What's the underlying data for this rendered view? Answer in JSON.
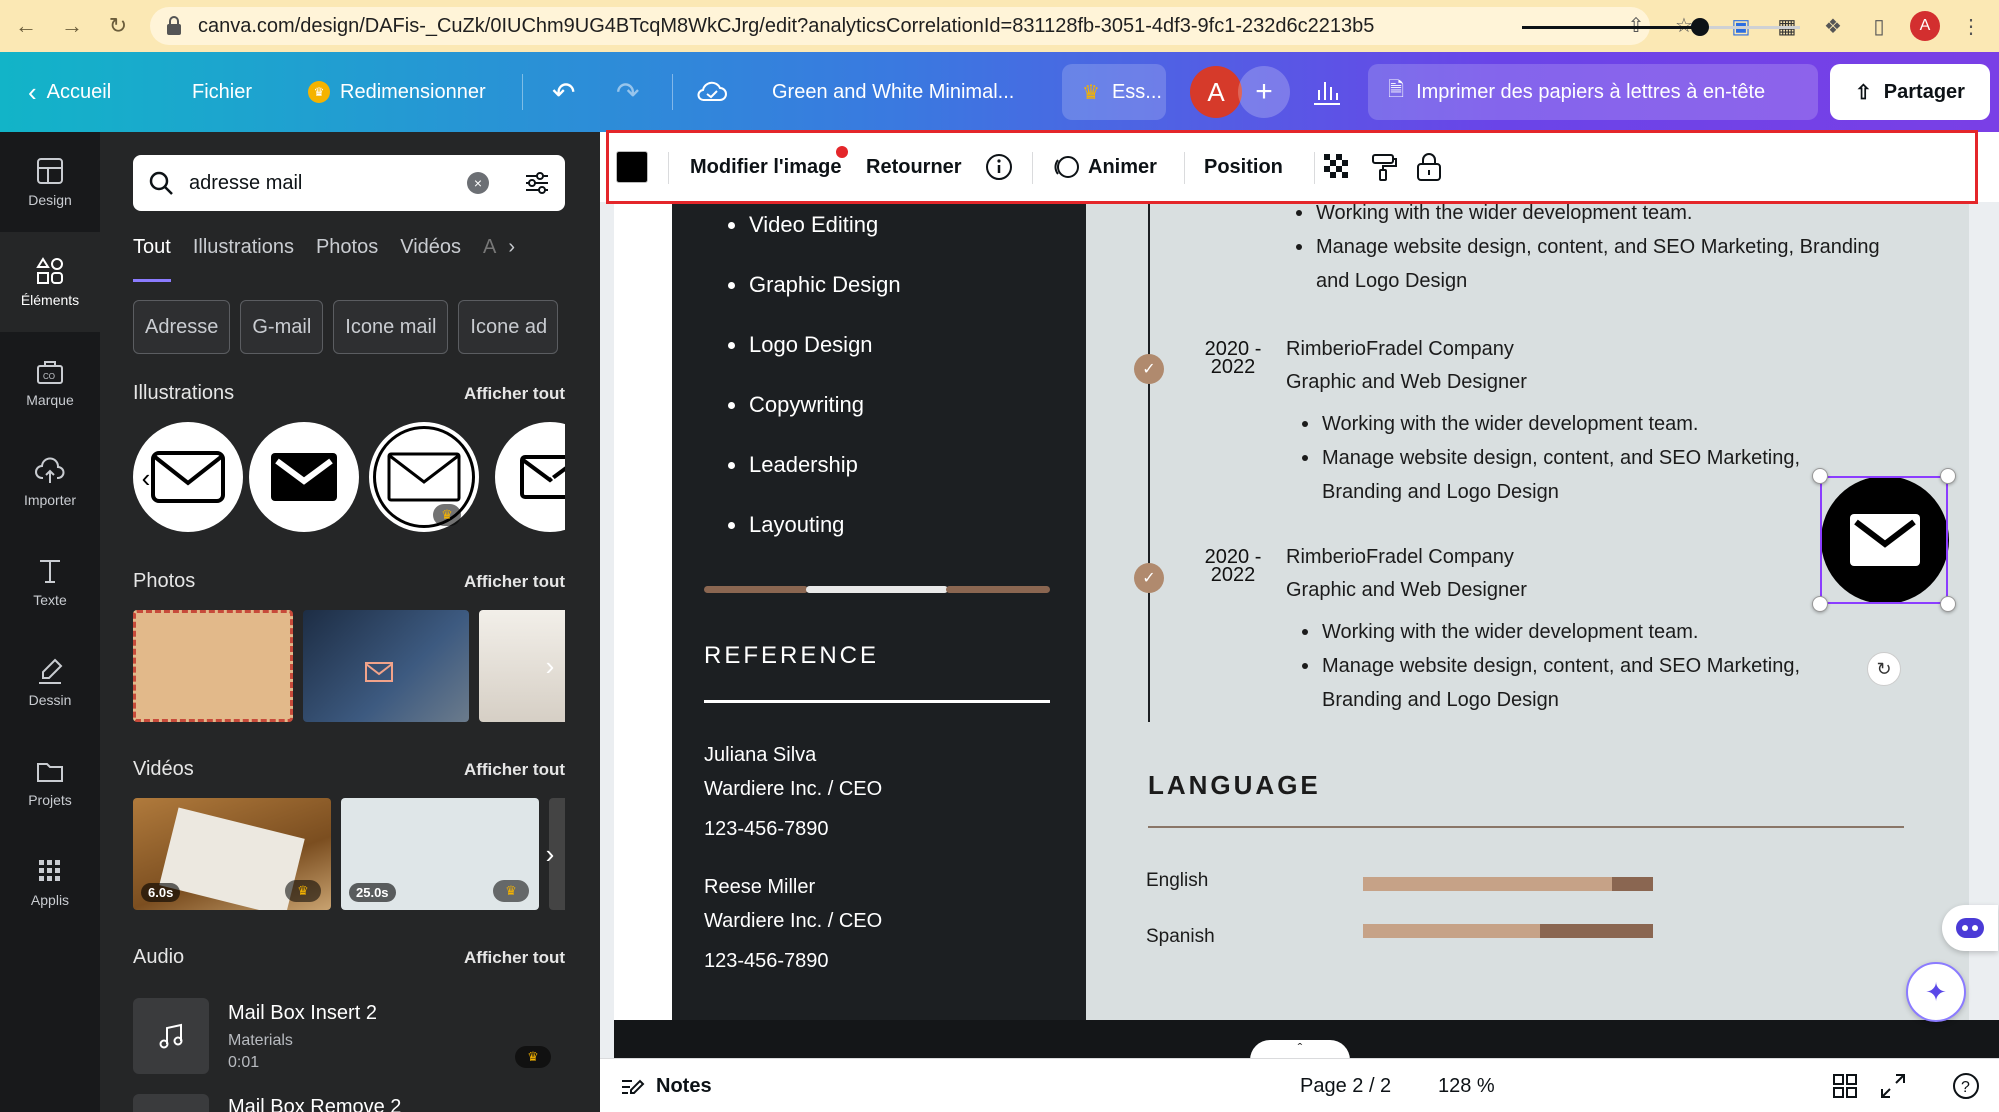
{
  "browser": {
    "url": "canva.com/design/DAFis-_CuZk/0IUChm9UG4BTcqM8WkCJrg/edit?analyticsCorrelationId=831128fb-3051-4df3-9fc1-232d6c2213b5",
    "profile_initial": "A"
  },
  "topbar": {
    "home": "Accueil",
    "file": "Fichier",
    "resize": "Redimensionner",
    "doc_title": "Green and White Minimal...",
    "trial": "Ess...",
    "user_initial": "A",
    "print": "Imprimer des papiers à lettres à en-tête",
    "share": "Partager"
  },
  "rail": {
    "items": [
      {
        "label": "Design",
        "icon": "layout-icon"
      },
      {
        "label": "Éléments",
        "icon": "shapes-icon"
      },
      {
        "label": "Marque",
        "icon": "brand-icon"
      },
      {
        "label": "Importer",
        "icon": "upload-icon"
      },
      {
        "label": "Texte",
        "icon": "text-icon"
      },
      {
        "label": "Dessin",
        "icon": "draw-icon"
      },
      {
        "label": "Projets",
        "icon": "folder-icon"
      },
      {
        "label": "Applis",
        "icon": "apps-icon"
      }
    ],
    "active_index": 1
  },
  "panel": {
    "search_value": "adresse mail",
    "tabs": [
      "Tout",
      "Illustrations",
      "Photos",
      "Vidéos",
      "A"
    ],
    "chips": [
      "Adresse",
      "G-mail",
      "Icone mail",
      "Icone ad"
    ],
    "illustrations": {
      "title": "Illustrations",
      "see_all": "Afficher tout"
    },
    "photos": {
      "title": "Photos",
      "see_all": "Afficher tout"
    },
    "videos": {
      "title": "Vidéos",
      "see_all": "Afficher tout",
      "durations": [
        "6.0s",
        "25.0s"
      ]
    },
    "audio": {
      "title": "Audio",
      "see_all": "Afficher tout",
      "items": [
        {
          "title": "Mail Box Insert 2",
          "artist": "Materials",
          "duration": "0:01"
        },
        {
          "title": "Mail Box Remove 2"
        }
      ]
    }
  },
  "context_toolbar": {
    "edit_image": "Modifier l'image",
    "flip": "Retourner",
    "animate": "Animer",
    "position": "Position"
  },
  "resume": {
    "skills": [
      "Video Editing",
      "Graphic Design",
      "Logo Design",
      "Copywriting",
      "Leadership",
      "Layouting"
    ],
    "reference_title": "REFERENCE",
    "references": [
      {
        "name": "Juliana Silva",
        "role": "Wardiere Inc. / CEO",
        "phone": "123-456-7890"
      },
      {
        "name": "Reese Miller",
        "role": "Wardiere Inc. / CEO",
        "phone": "123-456-7890"
      }
    ],
    "top_bullets": [
      "Working with the wider development team.",
      "Manage website design, content, and SEO Marketing, Branding",
      "and Logo Design"
    ],
    "experience": [
      {
        "year_a": "2020 -",
        "year_b": "2022",
        "company": "RimberioFradel Company",
        "title": "Graphic and Web Designer",
        "bullet1": "Working with the wider development team.",
        "bullet2a": "Manage website design, content, and SEO Marketing,",
        "bullet2b": "Branding and Logo Design"
      },
      {
        "year_a": "2020 -",
        "year_b": "2022",
        "company": "RimberioFradel Company",
        "title": "Graphic and Web Designer",
        "bullet1": "Working with the wider development team.",
        "bullet2a": "Manage website design, content, and SEO Marketing,",
        "bullet2b": "Branding and Logo Design"
      }
    ],
    "language_title": "LANGUAGE",
    "languages": [
      {
        "name": "English",
        "level": 0.86
      },
      {
        "name": "Spanish",
        "level": 0.61
      }
    ]
  },
  "status": {
    "notes": "Notes",
    "page": "Page 2 / 2",
    "zoom": "128 %",
    "zoom_level": 0.64
  },
  "colors": {
    "accent": "#8b3dff",
    "highlight_red": "#e4262a",
    "resume_dark": "#1c1f22",
    "resume_light": "#d9dfe0",
    "tan": "#c6a287",
    "brown": "#8a6651"
  }
}
